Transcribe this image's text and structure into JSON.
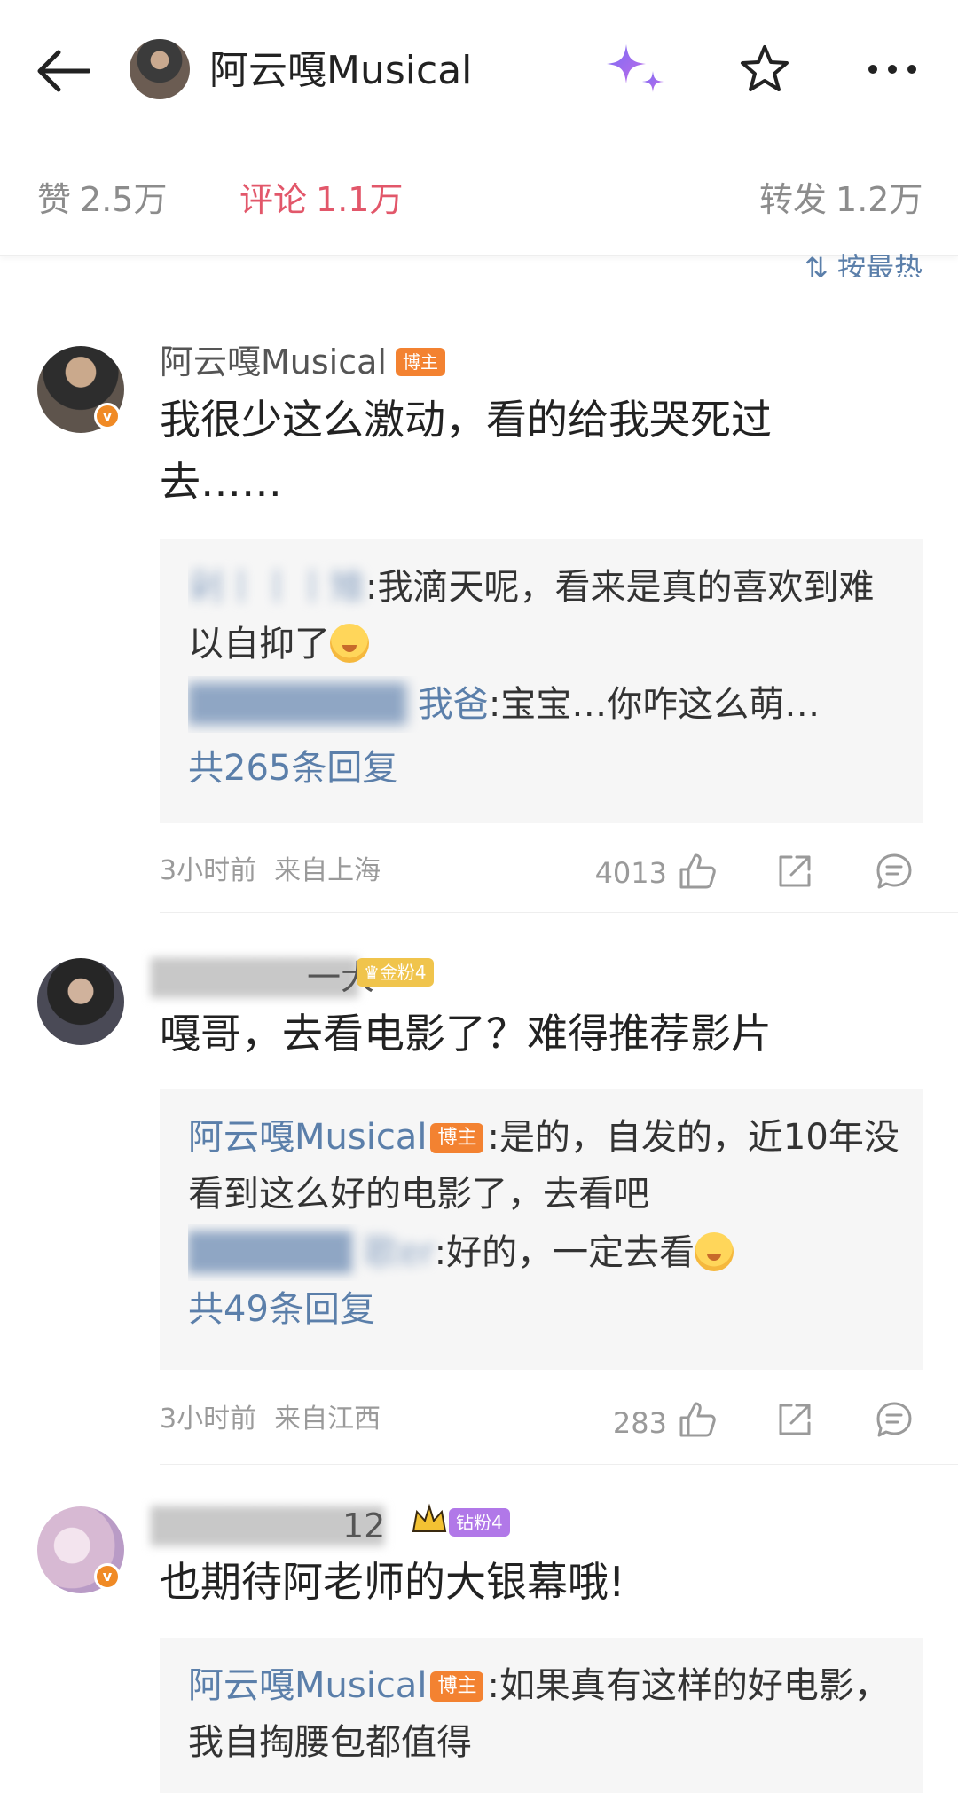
{
  "nav": {
    "title": "阿云嘎Musical",
    "icons": [
      "back-arrow-icon",
      "sparkle-icon",
      "star-icon",
      "more-icon"
    ]
  },
  "stats": {
    "likes_label": "赞",
    "likes_count": "2.5万",
    "comments_label": "评论",
    "comments_count": "1.1万",
    "reposts_label": "转发",
    "reposts_count": "1.2万"
  },
  "sort_label": "按最热",
  "colors": {
    "accent": "#e2576a",
    "link": "#5b7faa",
    "host_tag": "#f38231",
    "gold_tag": "#f0c44c",
    "diamond_tag": "#b178e8"
  },
  "comments": [
    {
      "user": "阿云嘎Musical",
      "tag": "博主",
      "text": "我很少这么激动，看的给我哭死过去……",
      "replies": [
        {
          "user": "剁丨丨丨雉",
          "sep": ":",
          "text": "我滴天呢，看来是真的喜欢到难以自抑了"
        },
        {
          "user": "我爸",
          "sep": ":",
          "text": "宝宝…你咋这么萌…"
        }
      ],
      "more": "共265条回复",
      "time": "3小时前",
      "location": "来自上海",
      "likes": "4013"
    },
    {
      "user": "一大",
      "tag": "金粉4",
      "text": "嘎哥，去看电影了？难得推荐影片",
      "replies": [
        {
          "user": "阿云嘎Musical",
          "tag": "博主",
          "sep": ":",
          "text": "是的，自发的，近10年没看到这么好的电影了，去看吧"
        },
        {
          "user": "歌er",
          "sep": ":",
          "text": "好的，一定去看"
        }
      ],
      "more": "共49条回复",
      "time": "3小时前",
      "location": "来自江西",
      "likes": "283"
    },
    {
      "user": "12",
      "tag": "钻粉4",
      "text": "也期待阿老师的大银幕哦!",
      "replies": [
        {
          "user": "阿云嘎Musical",
          "tag": "博主",
          "sep": ":",
          "text": "如果真有这样的好电影，我自掏腰包都值得"
        }
      ]
    }
  ]
}
